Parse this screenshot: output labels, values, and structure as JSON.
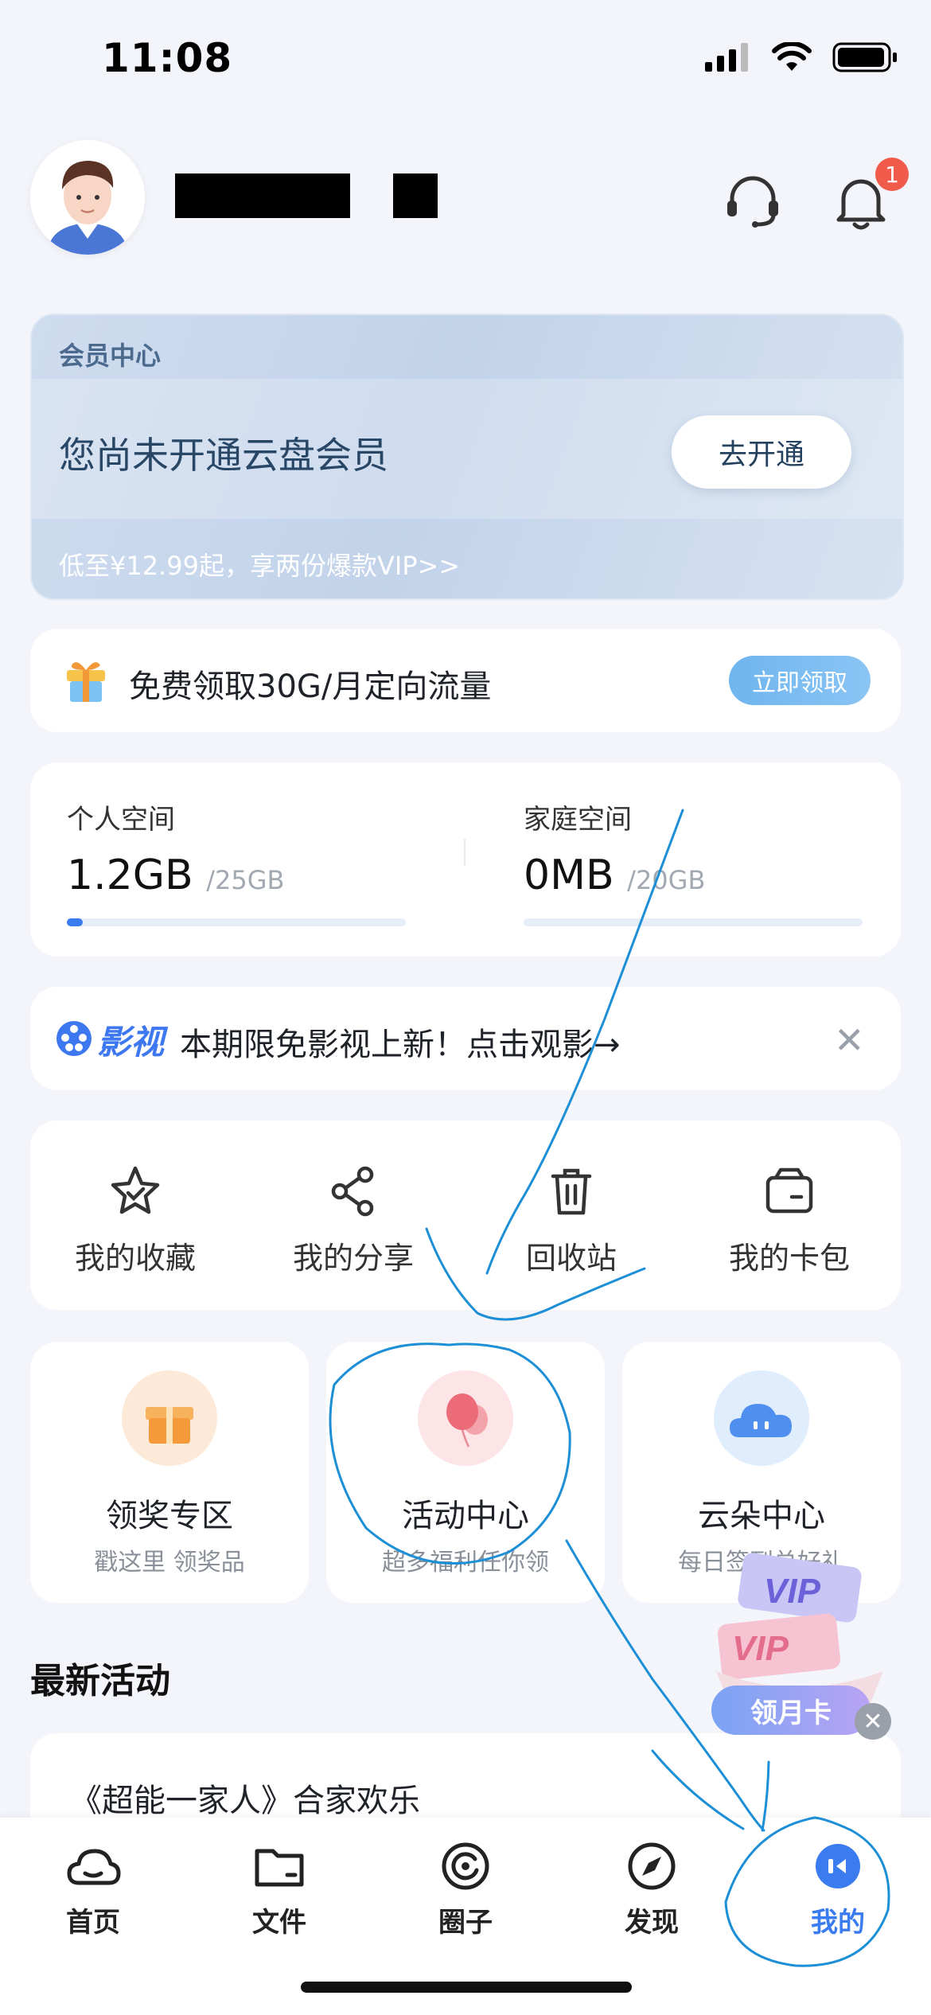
{
  "status_bar": {
    "time": "11:08"
  },
  "header": {
    "notification_count": "1"
  },
  "vip_card": {
    "title": "会员中心",
    "headline": "您尚未开通云盘会员",
    "button": "去开通",
    "footer": "低至¥12.99起，享两份爆款VIP>>"
  },
  "flow_banner": {
    "text": "免费领取30G/月定向流量",
    "button": "立即领取"
  },
  "storage": {
    "personal": {
      "label": "个人空间",
      "used": "1.2GB",
      "total": "/25GB",
      "fraction": 0.048
    },
    "family": {
      "label": "家庭空间",
      "used": "0MB",
      "total": "/20GB",
      "fraction": 0
    }
  },
  "movie_banner": {
    "brand": "影视",
    "text": "本期限免影视上新！点击观影→"
  },
  "quick_actions": [
    {
      "label": "我的收藏",
      "icon": "star-icon"
    },
    {
      "label": "我的分享",
      "icon": "share-icon"
    },
    {
      "label": "回收站",
      "icon": "trash-icon"
    },
    {
      "label": "我的卡包",
      "icon": "wallet-icon"
    }
  ],
  "promos": [
    {
      "title": "领奖专区",
      "subtitle": "戳这里 领奖品",
      "icon": "gift-box-icon"
    },
    {
      "title": "活动中心",
      "subtitle": "超多福利任你领",
      "icon": "balloon-icon"
    },
    {
      "title": "云朵中心",
      "subtitle": "每日签到兑好礼",
      "icon": "cloud-icon"
    }
  ],
  "latest": {
    "title": "最新活动",
    "item": "《超能一家人》合家欢乐"
  },
  "floating_promo": {
    "vip_text_1": "VIP",
    "vip_text_2": "VIP",
    "button": "领月卡"
  },
  "tabs": [
    {
      "label": "首页",
      "icon": "cloud-outline-icon"
    },
    {
      "label": "文件",
      "icon": "folder-icon"
    },
    {
      "label": "圈子",
      "icon": "circle-icon"
    },
    {
      "label": "发现",
      "icon": "compass-icon"
    },
    {
      "label": "我的",
      "icon": "profile-icon",
      "active": true
    }
  ],
  "colors": {
    "accent": "#3b7bf0",
    "scribble": "#1d8fd6",
    "badge": "#f05b4b"
  }
}
